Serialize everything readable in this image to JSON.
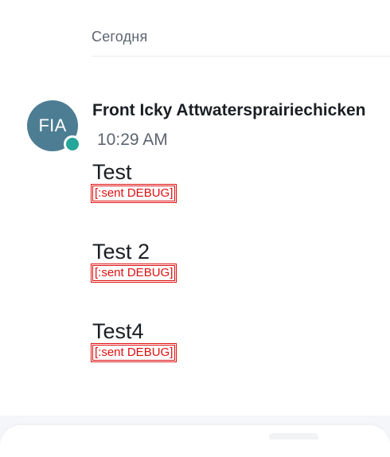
{
  "chat": {
    "date_separator": "Сегодня",
    "sender": {
      "initials": "FIA",
      "name": "Front Icky Attwatersprairiechicken",
      "time": "10:29 AM",
      "avatar_color": "#4d7d93",
      "presence_color": "#26a69a",
      "presence": "online"
    },
    "messages": [
      {
        "text": "Test",
        "debug": "[:sent DEBUG]"
      },
      {
        "text": "Test 2",
        "debug": "[:sent DEBUG]"
      },
      {
        "text": "Test4",
        "debug": "[:sent DEBUG]"
      }
    ]
  },
  "colors": {
    "debug": "#e01010",
    "text": "#1b1f24",
    "muted": "#5c6470"
  }
}
